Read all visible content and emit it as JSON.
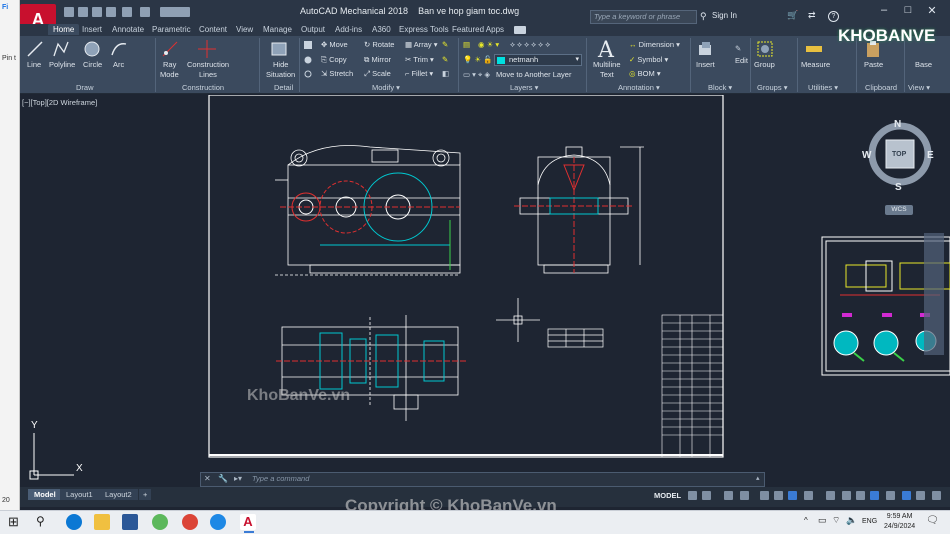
{
  "window": {
    "app_badge": "A",
    "app_name": "AutoCAD Mechanical 2018",
    "file_name": "Ban ve hop giam toc.dwg",
    "search_placeholder": "Type a keyword or phrase",
    "sign_in": "Sign In",
    "help": "?"
  },
  "ribbon_tabs": [
    "Home",
    "Insert",
    "Annotate",
    "Parametric",
    "Content",
    "View",
    "Manage",
    "Output",
    "Add-ins",
    "A360",
    "Express Tools",
    "Featured Apps"
  ],
  "active_tab": "Home",
  "ribbon": {
    "draw": {
      "line": "Line",
      "polyline": "Polyline",
      "circle": "Circle",
      "arc": "Arc",
      "group": "Draw"
    },
    "construction": {
      "ray": "Ray",
      "mode": "Mode",
      "construction": "Construction",
      "lines": "Lines",
      "group": "Construction"
    },
    "detail": {
      "hide": "Hide",
      "situation": "Situation",
      "group": "Detail"
    },
    "modify": {
      "move": "Move",
      "rotate": "Rotate",
      "array": "Array",
      "copy": "Copy",
      "mirror": "Mirror",
      "trim": "Trim",
      "stretch": "Stretch",
      "scale": "Scale",
      "fillet": "Fillet",
      "group": "Modify"
    },
    "layers": {
      "current_layer": "netmanh",
      "move_to_another_layer": "Move to Another Layer",
      "group": "Layers"
    },
    "annotation": {
      "multiline": "Multiline",
      "text": "Text",
      "dimension": "Dimension",
      "symbol": "Symbol",
      "bom": "BOM",
      "group": "Annotation"
    },
    "block": {
      "insert": "Insert",
      "edit": "Edit",
      "group": "Block"
    },
    "groups": {
      "group_btn": "Group",
      "group": "Groups"
    },
    "utilities": {
      "measure": "Measure",
      "group": "Utilities"
    },
    "clipboard": {
      "paste": "Paste",
      "group": "Clipboard"
    },
    "view": {
      "base": "Base",
      "group": "View"
    }
  },
  "viewport_label": "[−][Top][2D Wireframe]",
  "viewcube": {
    "north": "N",
    "south": "S",
    "east": "E",
    "west": "W",
    "face": "TOP",
    "wcs": "WCS"
  },
  "command_line": {
    "placeholder": "Type a command"
  },
  "layout_tabs": [
    "Model",
    "Layout1",
    "Layout2"
  ],
  "add_layout": "+",
  "status": {
    "mode": "MODEL"
  },
  "ucs": {
    "x": "X",
    "y": "Y"
  },
  "taskbar": {
    "language": "ENG",
    "time": "9:59 AM",
    "date": "24/9/2024"
  },
  "watermarks": {
    "logo": "KHOBANVE",
    "center": "KhoBanVe.vn",
    "copyright": "Copyright © KhoBanVe.vn"
  },
  "background_app": {
    "pin": "Pin t",
    "item1": "Fi",
    "item2": "20"
  },
  "colors": {
    "canvas": "#1e2532",
    "ribbon": "#3b4a5e",
    "titlebar": "#2b3646",
    "accent": "#c8102e",
    "drawing_line": "#ffffff",
    "highlight_cyan": "#00c8d0",
    "highlight_red": "#e03030",
    "highlight_green": "#3ad14a",
    "highlight_yellow": "#e8e82a",
    "highlight_magenta": "#d22ad2"
  }
}
